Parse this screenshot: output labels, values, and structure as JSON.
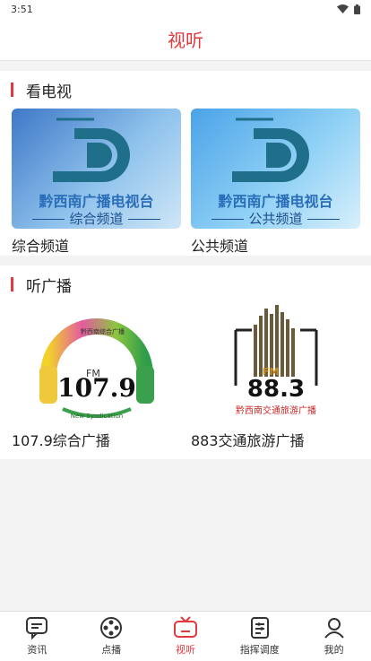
{
  "status": {
    "time": "3:51"
  },
  "header": {
    "title": "视听"
  },
  "tv_section": {
    "title": "看电视",
    "items": [
      {
        "label": "综合频道",
        "thumb_station": "黔西南广播电视台",
        "thumb_channel": "综合频道"
      },
      {
        "label": "公共频道",
        "thumb_station": "黔西南广播电视台",
        "thumb_channel": "公共频道"
      }
    ]
  },
  "radio_section": {
    "title": "听广播",
    "items": [
      {
        "label": "107.9综合广播",
        "logo_fm": "FM",
        "logo_freq": "107.9",
        "logo_top": "黔西南综合广播",
        "logo_bottom": "New Syndication"
      },
      {
        "label": "883交通旅游广播",
        "logo_fm": "FM",
        "logo_freq": "88.3",
        "logo_sub": "黔西南交通旅游广播"
      }
    ]
  },
  "tabbar": {
    "items": [
      {
        "label": "资讯",
        "icon": "chat-icon"
      },
      {
        "label": "点播",
        "icon": "film-reel-icon"
      },
      {
        "label": "视听",
        "icon": "tv-icon",
        "active": true
      },
      {
        "label": "指挥调度",
        "icon": "dispatch-icon"
      },
      {
        "label": "我的",
        "icon": "user-icon"
      }
    ]
  },
  "colors": {
    "accent": "#e0393e"
  }
}
